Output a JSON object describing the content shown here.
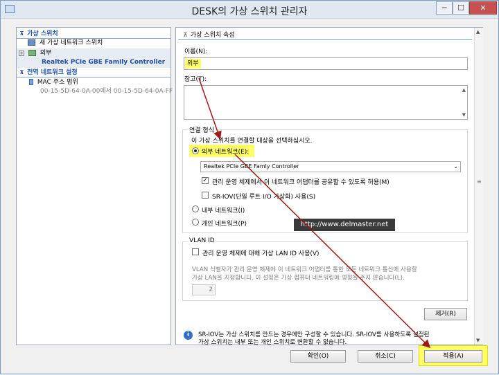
{
  "window": {
    "title": "DESK의 가상 스위치 관리자",
    "min_label": "─",
    "max_label": "☐",
    "close_label": "✕"
  },
  "tree": {
    "virtual_switches_header": "가상 스위치",
    "new_switch": "새 가상 네트워크 스위치",
    "switch_name": "외부",
    "switch_adapter": "Realtek PCIe GBE Family Controller",
    "global_header": "전역 네트워크 설정",
    "mac_range_label": "MAC 주소 범위",
    "mac_range_value": "00-15-5D-64-0A-00에서 00-15-5D-64-0A-FF"
  },
  "props": {
    "header": "가상 스위치 속성",
    "name_label": "이름(N):",
    "name_value": "외부",
    "notes_label": "참고(T):",
    "conn_group": "연결 형식",
    "conn_desc": "이 가상 스위치를 연결할 대상을 선택하십시오.",
    "external_label": "외부 네트워크(E):",
    "adapter_value": "Realtek PCIe GBE Famly Controller",
    "allow_mgmt": "관리 운영 체제에서 이 네트워크 어댑터를 공유할 수 있도록 허용(M)",
    "sriov": "SR-IOV(단일 루트 I/O 가상화) 사용(S)",
    "internal_label": "내부 네트워크(I)",
    "private_label": "개인 네트워크(P)",
    "vlan_group": "VLAN ID",
    "vlan_check": "관리 운영 체제에 대해 가상 LAN ID 사용(V)",
    "vlan_desc1": "VLAN 식별자가 관리 운영 체제에 이 네트워크 어댑터를 통한 모든 네트워크 통신에 사용할",
    "vlan_desc2": "가상 LAN을 지정합니다. 이 설정은 가상 컴퓨터 네트워킹에 영향을 주지 않습니다(L).",
    "vlan_value": "2",
    "remove_button": "제거(R)",
    "info_line1": "SR-IOV는 가상 스위치를 만드는 경우에만 구성할 수 있습니다. SR-IOV를 사용하도록 설정된",
    "info_line2": "가상 스위치는 내부 또는 개인 스위치로 변환할 수 없습니다."
  },
  "watermark": "http://www.delmaster.net",
  "footer": {
    "ok": "확인(O)",
    "cancel": "취소(C)",
    "apply": "적용(A)"
  },
  "colors": {
    "highlight": "#ffff66",
    "arrow": "#a01818",
    "section_blue": "#1b4fa8"
  }
}
